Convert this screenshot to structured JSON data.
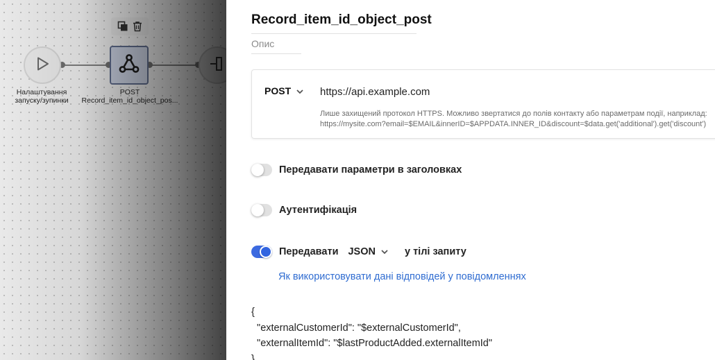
{
  "canvas": {
    "start_node": {
      "label_line1": "Налаштування",
      "label_line2": "запуску/зупинки",
      "icon": "play-icon"
    },
    "webhook_node": {
      "label_line1": "POST",
      "label_line2": "Record_item_id_object_pos...",
      "icon": "webhook-icon"
    },
    "end_node": {
      "icon": "exit-icon"
    },
    "toolbar": {
      "copy_icon": "copy-icon",
      "delete_icon": "trash-icon"
    }
  },
  "panel": {
    "title": "Record_item_id_object_post",
    "description_placeholder": "Опис",
    "request": {
      "method": "POST",
      "url": "https://api.example.com",
      "hint_line1": "Лише захищений протокол HTTPS. Можливо звертатися до полів контакту або параметрам події, наприклад:",
      "hint_line2": "https://mysite.com?email=$EMAIL&innerID=$APPDATA.INNER_ID&discount=$data.get('additional').get('discount')"
    },
    "headers_toggle": {
      "label": "Передавати параметри в заголовках",
      "on": false
    },
    "auth_toggle": {
      "label": "Аутентифікація",
      "on": false
    },
    "body_toggle": {
      "label_prefix": "Передавати",
      "format": "JSON",
      "label_suffix": "у тілі запиту",
      "on": true
    },
    "response_link": "Як використовувати дані відповідей у повідомленнях",
    "json_body": {
      "line1": "{",
      "line2": "  \"externalCustomerId\": \"$externalCustomerId\",",
      "line3": "  \"externalItemId\": \"$lastProductAdded.externalItemId\"",
      "line4": "}"
    },
    "colors": {
      "accent": "#3164e0",
      "link": "#2f6cd1"
    }
  }
}
